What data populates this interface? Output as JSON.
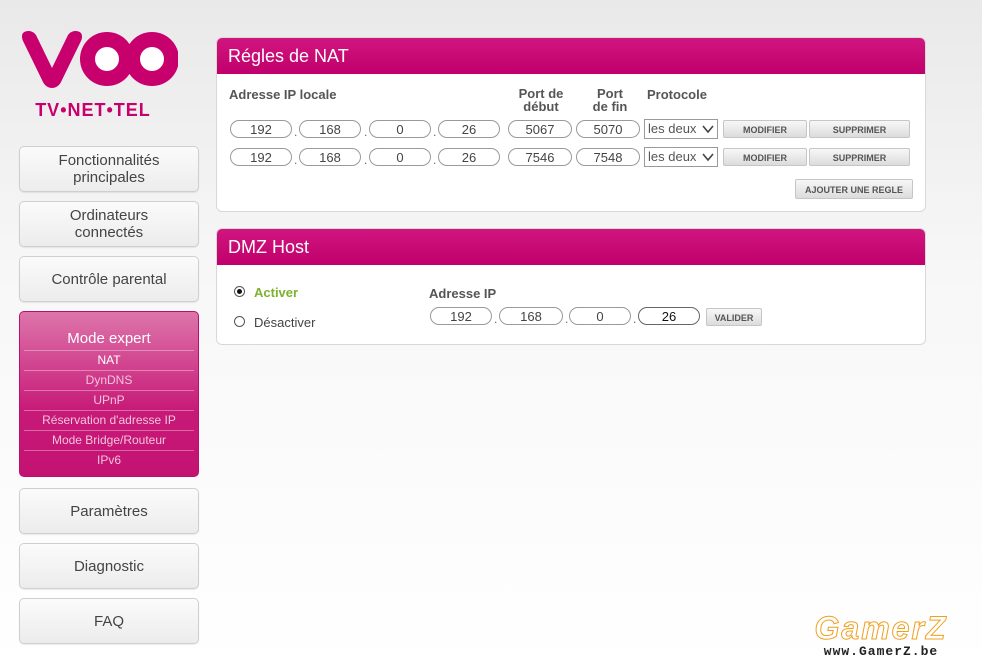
{
  "brand": {
    "logo_tagline": "TV•NET•TEL",
    "color": "#c8006e"
  },
  "nav": {
    "items_top": [
      {
        "label": "Fonctionnalités\nprincipales"
      },
      {
        "label": "Ordinateurs\nconnectés"
      },
      {
        "label": "Contrôle parental"
      }
    ],
    "expert": {
      "title": "Mode expert",
      "items": [
        "NAT",
        "DynDNS",
        "UPnP",
        "Réservation d'adresse IP",
        "Mode Bridge/Routeur",
        "IPv6"
      ],
      "active": "NAT"
    },
    "items_bottom": [
      {
        "label": "Paramètres"
      },
      {
        "label": "Diagnostic"
      },
      {
        "label": "FAQ"
      }
    ]
  },
  "nat": {
    "title": "Régles de NAT",
    "headers": {
      "ip": "Adresse IP locale",
      "port_start": "Port de\ndébut",
      "port_end": "Port\nde fin",
      "protocol": "Protocole"
    },
    "rows": [
      {
        "ip": [
          "192",
          "168",
          "0",
          "26"
        ],
        "port_start": "5067",
        "port_end": "5070",
        "protocol": "les deux",
        "modify": "MODIFIER",
        "delete": "SUPPRIMER"
      },
      {
        "ip": [
          "192",
          "168",
          "0",
          "26"
        ],
        "port_start": "7546",
        "port_end": "7548",
        "protocol": "les deux",
        "modify": "MODIFIER",
        "delete": "SUPPRIMER"
      }
    ],
    "add_rule": "AJOUTER UNE REGLE"
  },
  "dmz": {
    "title": "DMZ Host",
    "enable_label": "Activer",
    "disable_label": "Désactiver",
    "enabled": true,
    "ip_label": "Adresse IP",
    "ip": [
      "192",
      "168",
      "0",
      "26"
    ],
    "validate": "VALIDER",
    "accent": "#7db12e"
  },
  "watermark": {
    "line1": "GamerZ",
    "line2": "www.GamerZ.be"
  }
}
